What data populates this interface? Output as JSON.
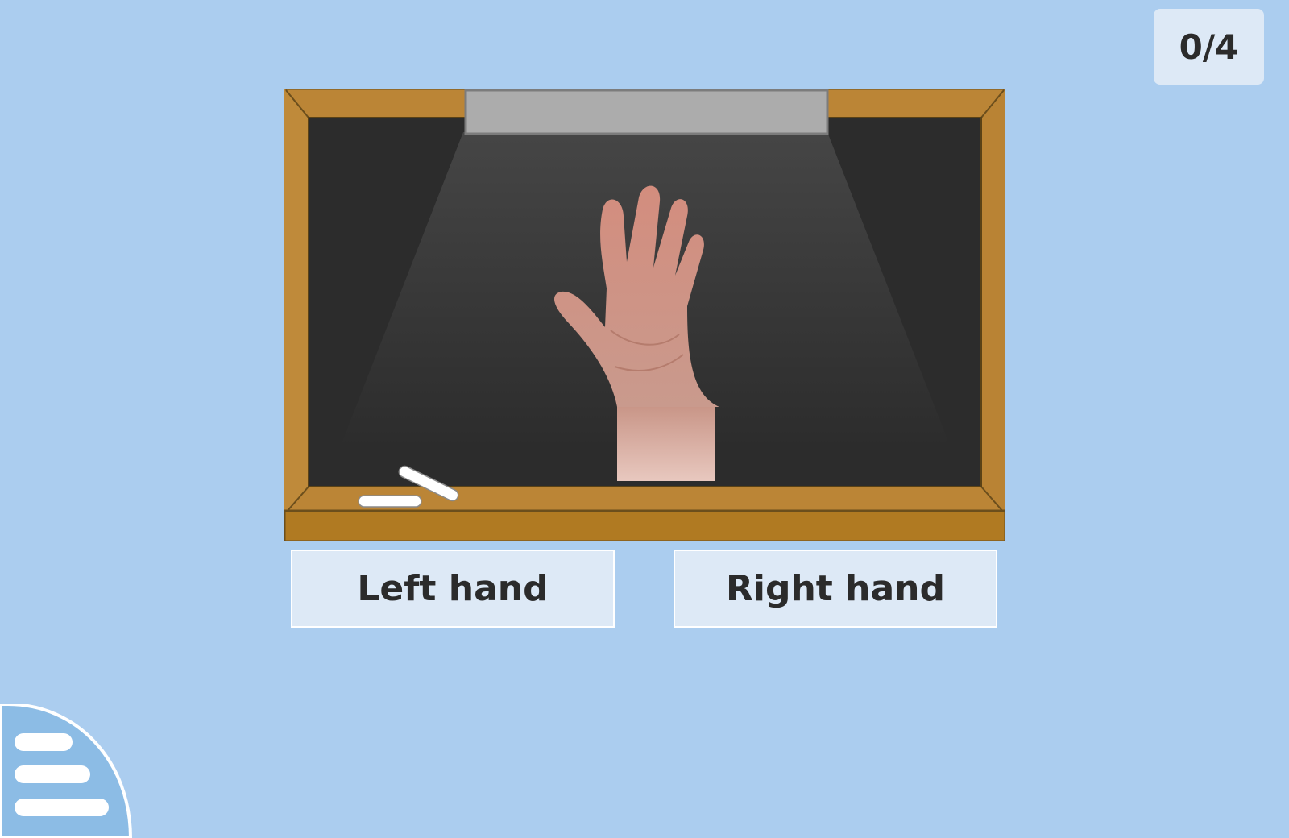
{
  "score": {
    "text": "0/4",
    "answered": 0,
    "total": 4
  },
  "question": {
    "image": "raised-open-hand"
  },
  "answers": [
    {
      "label": "Left hand"
    },
    {
      "label": "Right hand"
    }
  ],
  "menu": {
    "icon": "menu-icon"
  },
  "colors": {
    "background": "#abcdef",
    "panel": "#dde9f6",
    "board_frame": "#bb8536",
    "board_surface": "#2c2c2c",
    "lamp": "#acacac",
    "text": "#2b2b2b"
  }
}
